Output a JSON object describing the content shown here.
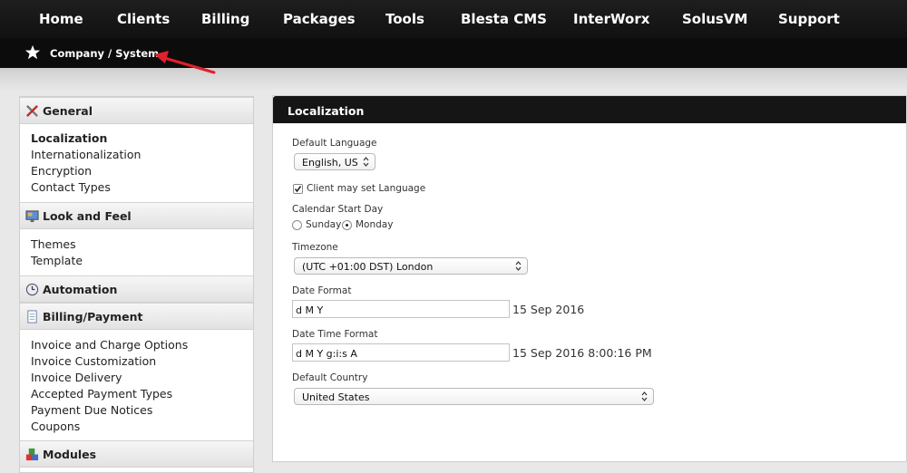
{
  "nav": {
    "items": [
      "Home",
      "Clients",
      "Billing",
      "Packages",
      "Tools",
      "Blesta CMS",
      "InterWorx",
      "SolusVM",
      "Support"
    ]
  },
  "breadcrumb": {
    "text": "Company / System"
  },
  "sidebar": {
    "general": {
      "title": "General",
      "links": [
        "Localization",
        "Internationalization",
        "Encryption",
        "Contact Types"
      ]
    },
    "look": {
      "title": "Look and Feel",
      "links": [
        "Themes",
        "Template"
      ]
    },
    "automation": {
      "title": "Automation"
    },
    "billing": {
      "title": "Billing/Payment",
      "links": [
        "Invoice and Charge Options",
        "Invoice Customization",
        "Invoice Delivery",
        "Accepted Payment Types",
        "Payment Due Notices",
        "Coupons"
      ]
    },
    "modules": {
      "title": "Modules"
    }
  },
  "panel": {
    "title": "Localization",
    "default_language_label": "Default Language",
    "default_language_value": "English, US",
    "client_language_label": "Client may set Language",
    "client_language_checked": true,
    "calendar_label": "Calendar Start Day",
    "calendar_options": [
      "Sunday",
      "Monday"
    ],
    "calendar_selected": "Monday",
    "timezone_label": "Timezone",
    "timezone_value": "(UTC +01:00 DST) London",
    "date_format_label": "Date Format",
    "date_format_value": "d M Y",
    "date_format_preview": "15 Sep 2016",
    "datetime_format_label": "Date Time Format",
    "datetime_format_value": "d M Y g:i:s A",
    "datetime_format_preview": "15 Sep 2016 8:00:16 PM",
    "country_label": "Default Country",
    "country_value": "United States"
  },
  "colors": {
    "topbar": "#151515",
    "annotation_arrow": "#e0202a"
  }
}
